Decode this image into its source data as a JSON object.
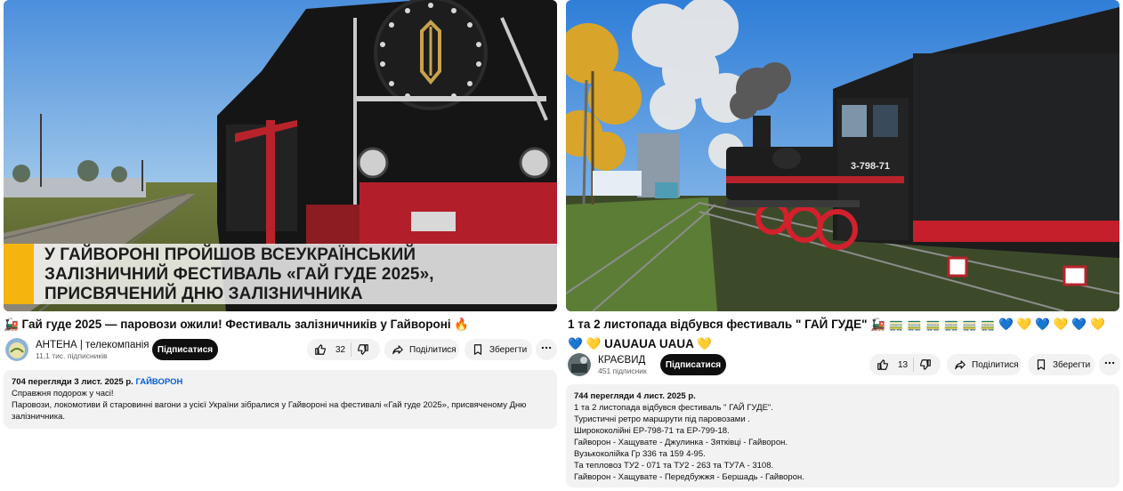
{
  "left": {
    "overlay_text": "У ГАЙВОРОНІ ПРОЙШОВ ВСЕУКРАЇНСЬКИЙ ЗАЛІЗНИЧНИЙ ФЕСТИВАЛЬ «ГАЙ ГУДЕ 2025», ПРИСВЯЧЕНИЙ ДНЮ ЗАЛІЗНИЧНИКА",
    "title": "🚂 Гай гуде 2025 — паровози ожили! Фестиваль залізничників у Гайвороні 🔥",
    "channel_name": "АНТЕНА | телекомпанія",
    "subscribers": "11,1 тис. підписників",
    "subscribe_label": "Підписатися",
    "likes": "32",
    "share_label": "Поділитися",
    "save_label": "Зберегти",
    "desc_meta": "704 перегляди  3 лист. 2025 р.",
    "desc_tag": "ГАЙВОРОН",
    "desc_lines": [
      "Справжня подорож у часі!",
      "Паровози, локомотиви й старовинні вагони з усієї України зібралися у Гайвороні на фестивалі «Гай гуде 2025», присвяченому Дню",
      "залізничника."
    ]
  },
  "right": {
    "loco_number": "3-798-71",
    "title": "1 та 2 листопада відбувся фестиваль \" ГАЙ ГУДЕ\" 🚂 🚃 🚃 🚃 🚃 🚃 🚃 💙 💛 💙 💛 💙 💛 💙 💛 UAUAUA UAUA 💛",
    "channel_name": "КРАЄВИД",
    "subscribers": "451 підписник",
    "subscribe_label": "Підписатися",
    "likes": "13",
    "share_label": "Поділитися",
    "save_label": "Зберегти",
    "desc_meta": "744 перегляди  4 лист. 2025 р.",
    "desc_lines": [
      "1 та 2 листопада відбувся фестиваль \" ГАЙ ГУДЕ\".",
      "Туристичні ретро маршрути під паровозами .",
      "Ширококолійні ЕР-798-71 та ЕР-799-18.",
      "Гайворон - Хащувате - Джулинка - Зятківці - Гайворон.",
      "Вузькоколійка Гр 336 та 159 4-95.",
      "Та тепловоз ТУ2 - 071 та ТУ2 - 263 та ТУ7А - 3108.",
      "Гайворон - Хащувате - Передбужжя - Бершадь - Гайворон."
    ]
  }
}
